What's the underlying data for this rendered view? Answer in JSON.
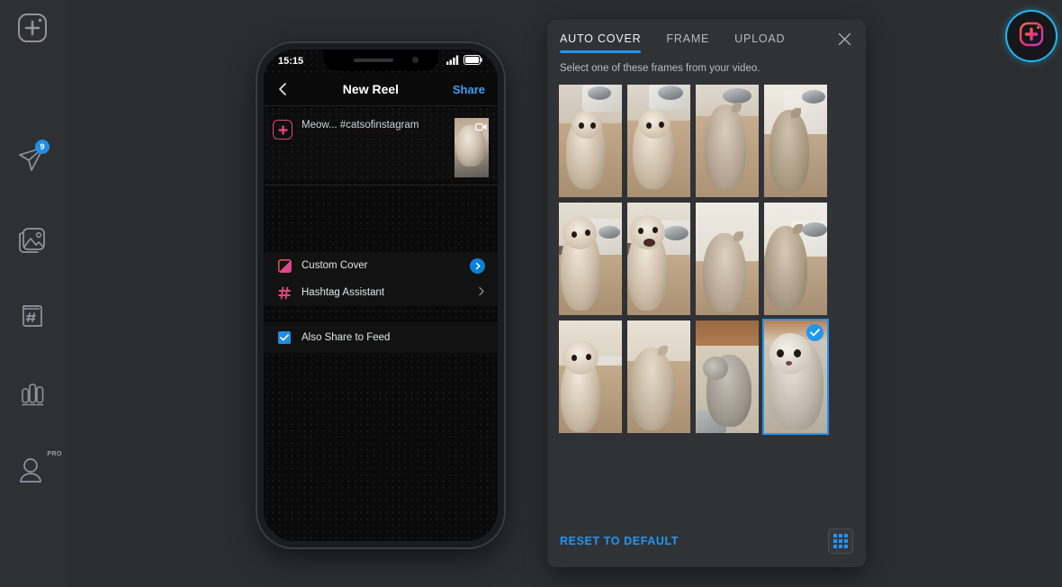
{
  "sidebar": {
    "items": [
      {
        "name": "create-post",
        "icon": "plus-square-icon",
        "badge": null
      },
      {
        "name": "scheduled-send",
        "icon": "paper-plane-icon",
        "badge": "9"
      },
      {
        "name": "media-library",
        "icon": "photos-icon",
        "badge": null
      },
      {
        "name": "hashtag-manager",
        "icon": "hashtag-book-icon",
        "badge": null
      },
      {
        "name": "analytics",
        "icon": "bar-chart-icon",
        "badge": null
      },
      {
        "name": "account",
        "icon": "user-icon",
        "badge": "PRO"
      }
    ]
  },
  "logo": {
    "name": "app-logo",
    "icon": "plus-square-circle-icon"
  },
  "phone": {
    "status_bar": {
      "time": "15:15",
      "signal_icon": "cellular-bars-icon",
      "battery_icon": "battery-icon"
    },
    "nav": {
      "back_icon": "chevron-left-icon",
      "title": "New Reel",
      "share_label": "Share"
    },
    "caption": {
      "avatar_icon": "app-avatar-icon",
      "text": "Meow... ",
      "hashtag": "#catsofinstagram",
      "thumb_icon": "video-camera-icon"
    },
    "menu": [
      {
        "label": "Custom Cover",
        "icon": "image-crop-icon",
        "chevron": "chevron-right-filled-icon",
        "accent": "#0c7fd8"
      },
      {
        "label": "Hashtag Assistant",
        "icon": "hashtag-icon",
        "chevron": "chevron-right-icon",
        "accent": "#6b7076"
      }
    ],
    "share_to_feed": {
      "label": "Also Share to Feed",
      "checked": true,
      "icon": "checkmark-icon"
    }
  },
  "panel": {
    "tabs": [
      {
        "label": "AUTO COVER",
        "active": true
      },
      {
        "label": "FRAME",
        "active": false
      },
      {
        "label": "UPLOAD",
        "active": false
      }
    ],
    "close_icon": "close-icon",
    "subtitle": "Select one of these frames from your video.",
    "frames": [
      {
        "id": 1,
        "selected": false,
        "scene": "cat-sitting-looking-up"
      },
      {
        "id": 2,
        "selected": false,
        "scene": "cat-sitting-looking-up"
      },
      {
        "id": 3,
        "selected": false,
        "scene": "cat-turned-away"
      },
      {
        "id": 4,
        "selected": false,
        "scene": "cat-at-bowl"
      },
      {
        "id": 5,
        "selected": false,
        "scene": "cat-looking-up-left"
      },
      {
        "id": 6,
        "selected": false,
        "scene": "cat-mouth-open"
      },
      {
        "id": 7,
        "selected": false,
        "scene": "cat-back-turned"
      },
      {
        "id": 8,
        "selected": false,
        "scene": "cat-eating"
      },
      {
        "id": 9,
        "selected": false,
        "scene": "cat-standing-front"
      },
      {
        "id": 10,
        "selected": false,
        "scene": "cat-side-profile"
      },
      {
        "id": 11,
        "selected": false,
        "scene": "cat-on-carpet"
      },
      {
        "id": 12,
        "selected": true,
        "scene": "cat-close-up-face"
      }
    ],
    "selected_frame_id": 12,
    "footer": {
      "reset_label": "RESET TO DEFAULT",
      "grid_button_icon": "grid-view-icon"
    }
  },
  "colors": {
    "accent_blue": "#2196f3",
    "panel_bg": "#303236",
    "app_bg": "#2b2d30",
    "sidebar_bg": "#2e3034",
    "phone_screen": "#000000"
  }
}
